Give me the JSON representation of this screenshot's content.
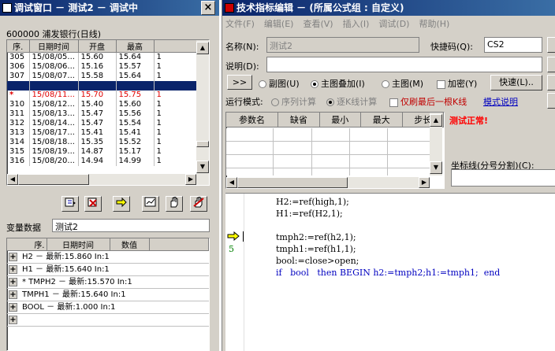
{
  "left": {
    "title": "调试窗口 － 测试2 － 调试中",
    "close": "×",
    "stock": "600000 浦发银行(日线)",
    "table": {
      "headers": [
        "序.",
        "日期时间",
        "开盘",
        "最高",
        ""
      ],
      "rows": [
        [
          "305",
          "15/08/05...",
          "15.60",
          "15.64",
          "1"
        ],
        [
          "306",
          "15/08/06...",
          "15.16",
          "15.57",
          "1"
        ],
        [
          "307",
          "15/08/07...",
          "15.58",
          "15.64",
          "1"
        ],
        [
          "",
          "",
          "",
          "",
          ""
        ],
        [
          "*",
          "15/08/11...",
          "15.70",
          "15.75",
          "1"
        ],
        [
          "310",
          "15/08/12...",
          "15.40",
          "15.60",
          "1"
        ],
        [
          "311",
          "15/08/13...",
          "15.47",
          "15.56",
          "1"
        ],
        [
          "312",
          "15/08/14...",
          "15.47",
          "15.54",
          "1"
        ],
        [
          "313",
          "15/08/17...",
          "15.41",
          "15.41",
          "1"
        ],
        [
          "314",
          "15/08/18...",
          "15.35",
          "15.52",
          "1"
        ],
        [
          "315",
          "15/08/19...",
          "14.87",
          "15.17",
          "1"
        ],
        [
          "316",
          "15/08/20...",
          "14.94",
          "14.99",
          "1"
        ]
      ]
    },
    "var_label": "变量数据",
    "var_value": "测试2",
    "var_headers": [
      "序.",
      "日期时间",
      "数值"
    ],
    "tree": [
      "H2  －  最新:15.860  In:1",
      "H1  －  最新:15.640  In:1",
      "* TMPH2  －  最新:15.570  In:1",
      "TMPH1  －  最新:15.640  In:1",
      "BOOL  －  最新:1.000  In:1",
      ""
    ]
  },
  "right": {
    "title": "技术指标编辑 － (所属公式组 : 自定义)",
    "menu": [
      "文件(F)",
      "编辑(E)",
      "查看(V)",
      "插入(I)",
      "调试(D)",
      "帮助(H)"
    ],
    "name_label": "名称(N):",
    "name_value": "测试2",
    "shortcut_label": "快捷码(Q):",
    "shortcut_value": "CS2",
    "desc_label": "说明(D):",
    "expand_btn": ">>",
    "radio_sub": "副图(U)",
    "radio_main_overlay": "主图叠加(I)",
    "radio_main": "主图(M)",
    "check_encrypt": "加密(Y)",
    "fast_btn": "快速(L)..",
    "run_mode_label": "运行模式:",
    "run_seq": "序列计算",
    "run_bar": "逐K线计算",
    "only_last": "仅刷最后一根K线",
    "mode_help": "模式说明",
    "param_headers": [
      "参数名",
      "缺省",
      "最小",
      "最大",
      "步长"
    ],
    "status": "测试正常!",
    "coord_label": "坐标线(分号分割)(C):",
    "line_number": "5",
    "code": [
      "H2:=ref(high,1);",
      "H1:=ref(H2,1);",
      "",
      "tmph2:=ref(h2,1);",
      "tmph1:=ref(h1,1);",
      "bool:=close>open;",
      "if   bool   then BEGIN h2:=tmph2;h1:=tmph1;  end"
    ]
  },
  "colors": {
    "selection": "#0a246a",
    "red": "#e00000",
    "status_red": "#ff0000",
    "link": "#0000c0"
  }
}
